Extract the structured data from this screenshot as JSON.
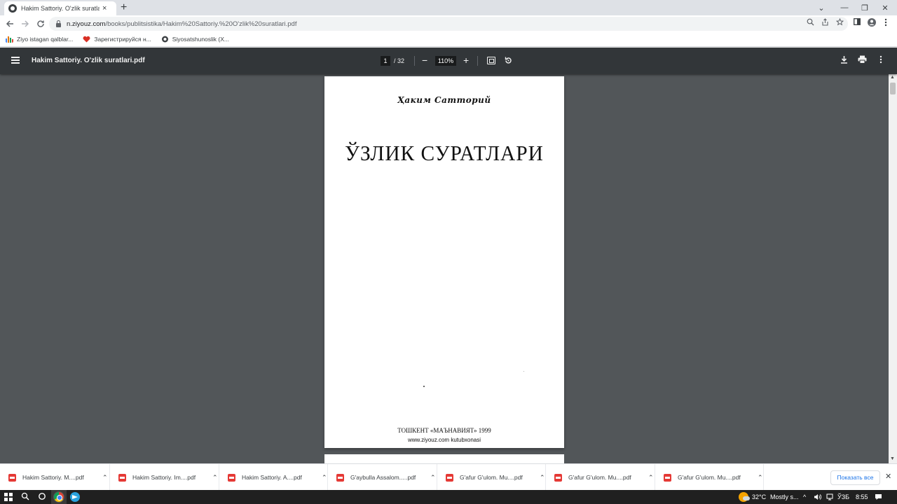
{
  "browser": {
    "tab_title": "Hakim Sattoriy. O'zlik suratlari.pdf",
    "tab_close": "×",
    "new_tab": "+",
    "url_domain": "n.ziyouz.com",
    "url_path": "/books/publitsistika/Hakim%20Sattoriy.%20O'zlik%20suratlari.pdf",
    "window_controls": [
      "⌄",
      "—",
      "❐",
      "✕"
    ]
  },
  "bookmarks": [
    {
      "label": "Ziyo istagan qalblar...",
      "icon": "ziyo-bars-icon",
      "color": "#e37400"
    },
    {
      "label": "Зарегистрируйся н...",
      "icon": "heart-icon",
      "color": "#d93025"
    },
    {
      "label": "Siyosatshunoslik (X...",
      "icon": "globe-icon",
      "color": "#3c4043"
    }
  ],
  "pdf_toolbar": {
    "title": "Hakim Sattoriy. O'zlik suratlari.pdf",
    "current_page": "1",
    "total_pages": "/ 32",
    "zoom": "110%",
    "zoom_out": "−",
    "zoom_in": "+"
  },
  "page": {
    "author": "Ҳаким Сатторий",
    "title": "ЎЗЛИК СУРАТЛАРИ",
    "publisher": "ТОШКЕНТ «МАЪНАВИЯТ» 1999",
    "website": "www.ziyouz.com kutubxonasi"
  },
  "downloads": {
    "items": [
      {
        "name": "Hakim Sattoriy. M....pdf"
      },
      {
        "name": "Hakim Sattoriy. Im....pdf"
      },
      {
        "name": "Hakim Sattoriy. A....pdf"
      },
      {
        "name": "G'aybulla Assalom.....pdf"
      },
      {
        "name": "G'afur G'ulom. Mu....pdf"
      },
      {
        "name": "G'afur G'ulom. Mu....pdf"
      },
      {
        "name": "G'afur G'ulom. Mu....pdf"
      }
    ],
    "show_all": "Показать все",
    "close": "✕"
  },
  "taskbar": {
    "temperature": "32°C",
    "weather": "Mostly s...",
    "language": "ЎЗБ",
    "time": "8:55"
  }
}
